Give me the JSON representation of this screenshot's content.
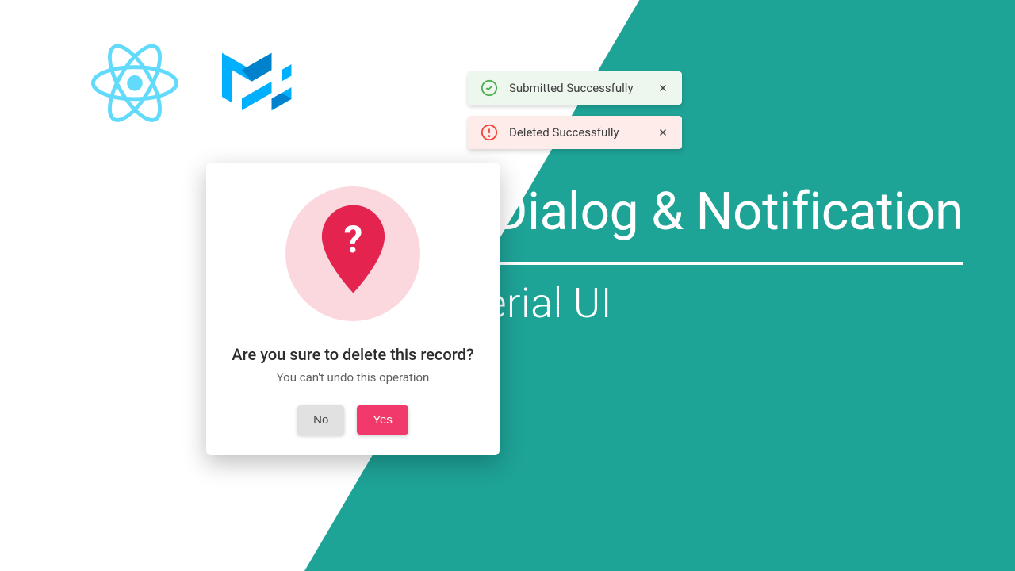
{
  "colors": {
    "teal": "#1ea397",
    "accent": "#f2396b",
    "success_bg": "#edf7ee",
    "error_bg": "#fdecea"
  },
  "alerts": {
    "success": {
      "text": "Submitted Successfully"
    },
    "error": {
      "text": "Deleted Successfully"
    }
  },
  "dialog": {
    "title": "Are you sure to delete this record?",
    "subtitle": "You can't undo this operation",
    "no_label": "No",
    "yes_label": "Yes"
  },
  "heading": {
    "line": "Confirm Dialog & Notification",
    "sub": "React Material UI"
  }
}
